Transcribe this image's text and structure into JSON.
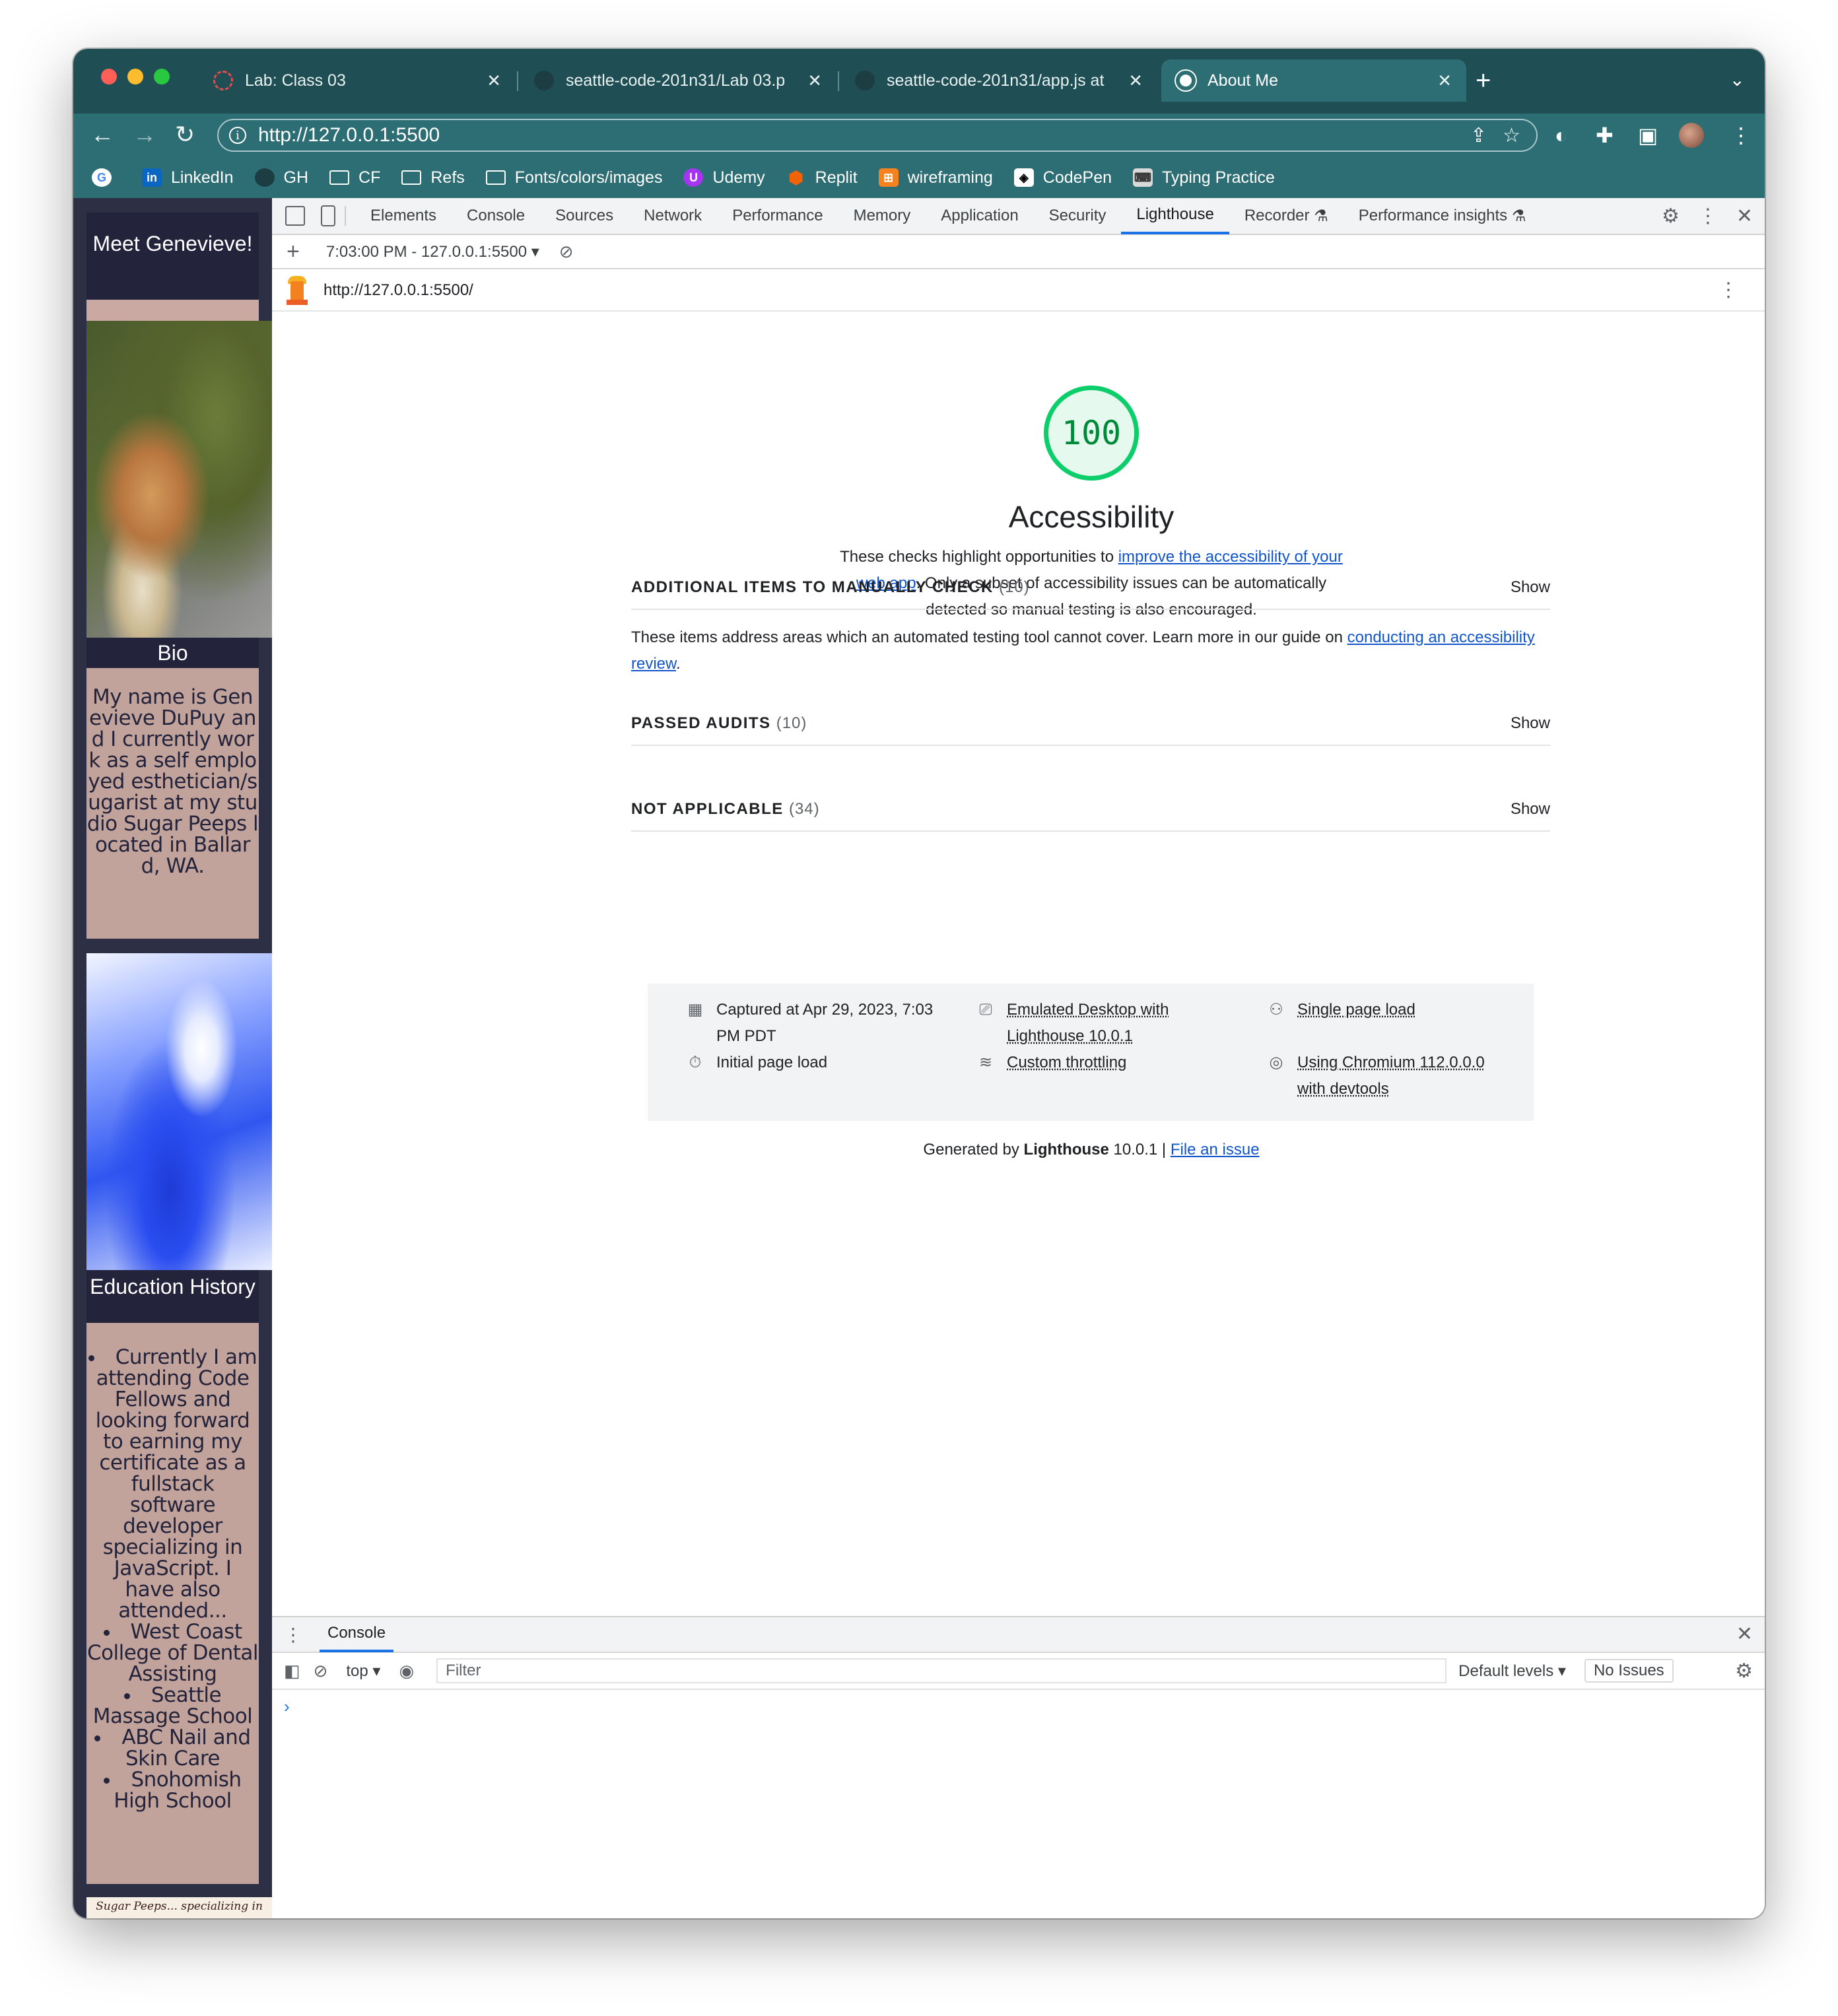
{
  "browser": {
    "tabs": [
      {
        "title": "Lab: Class 03"
      },
      {
        "title": "seattle-code-201n31/Lab 03.p"
      },
      {
        "title": "seattle-code-201n31/app.js at"
      },
      {
        "title": "About Me"
      }
    ],
    "url": "http://127.0.0.1:5500",
    "bookmarks": [
      "LinkedIn",
      "GH",
      "CF",
      "Refs",
      "Fonts/colors/images",
      "Udemy",
      "Replit",
      "wireframing",
      "CodePen",
      "Typing Practice"
    ]
  },
  "site": {
    "header": "Meet Genevieve!",
    "bio_title": "Bio",
    "bio_text": "My name is Genevieve DuPuy and I currently work as a self employed esthetician/sugarist at my studio Sugar Peeps located in Ballard, WA.",
    "edu_title": "Education History",
    "edu_intro": "Currently I am attending Code Fellows and looking forward to earning my certificate as a fullstack software developer specializing in JavaScript. I have also attended...",
    "edu_items": [
      "West Coast College of Dental Assisting",
      "Seattle Massage School",
      "ABC Nail and Skin Care",
      "Snohomish High School"
    ],
    "logo_text": "Sugar Peeps... specializing in sugar Be sweet to your skin!"
  },
  "devtools": {
    "tabs": [
      "Elements",
      "Console",
      "Sources",
      "Network",
      "Performance",
      "Memory",
      "Application",
      "Security",
      "Lighthouse",
      "Recorder",
      "Performance insights"
    ],
    "active_tab": "Lighthouse",
    "report_select": "7:03:00 PM - 127.0.0.1:5500",
    "report_url": "http://127.0.0.1:5500/"
  },
  "report": {
    "score": "100",
    "category": "Accessibility",
    "desc_pre": "These checks highlight opportunities to ",
    "desc_link": "improve the accessibility of your web app",
    "desc_post": ". Only a subset of accessibility issues can be automatically detected so manual testing is also encouraged.",
    "groups": [
      {
        "title": "ADDITIONAL ITEMS TO MANUALLY CHECK",
        "count": "(10)",
        "show": "Show"
      },
      {
        "title": "PASSED AUDITS",
        "count": "(10)",
        "show": "Show"
      },
      {
        "title": "NOT APPLICABLE",
        "count": "(34)",
        "show": "Show"
      }
    ],
    "manual_desc_pre": "These items address areas which an automated testing tool cannot cover. Learn more in our guide on ",
    "manual_desc_link": "conducting an accessibility review",
    "manual_desc_post": ".",
    "env": {
      "captured": "Captured at Apr 29, 2023, 7:03 PM PDT",
      "initial": "Initial page load",
      "emulated": "Emulated Desktop with Lighthouse 10.0.1",
      "throttling": "Custom throttling",
      "single": "Single page load",
      "chromium": "Using Chromium 112.0.0.0 with devtools"
    },
    "footer_pre": "Generated by ",
    "footer_brand": "Lighthouse",
    "footer_version": " 10.0.1 | ",
    "footer_link": "File an issue"
  },
  "console": {
    "tab": "Console",
    "context": "top",
    "filter_placeholder": "Filter",
    "levels": "Default levels",
    "issues": "No Issues",
    "prompt": "›"
  }
}
